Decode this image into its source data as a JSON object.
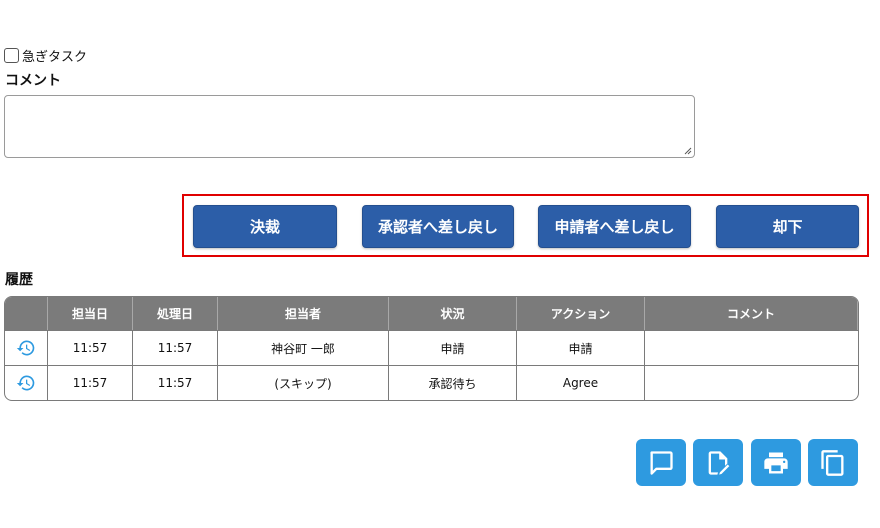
{
  "urgent": {
    "label": "急ぎタスク",
    "checked": false
  },
  "comment": {
    "label": "コメント",
    "value": ""
  },
  "actions": {
    "decide": "決裁",
    "return_to_approver": "承認者へ差し戻し",
    "return_to_applicant": "申請者へ差し戻し",
    "reject": "却下"
  },
  "history": {
    "label": "履歴",
    "headers": [
      "",
      "担当日",
      "処理日",
      "担当者",
      "状況",
      "アクション",
      "コメント"
    ],
    "rows": [
      {
        "icon": "history-icon",
        "assigned": "11:57",
        "processed": "11:57",
        "assignee": "神谷町 一郎",
        "status": "申請",
        "action": "申請",
        "comment": ""
      },
      {
        "icon": "history-icon",
        "assigned": "11:57",
        "processed": "11:57",
        "assignee": "(スキップ)",
        "status": "承認待ち",
        "action": "Agree",
        "comment": ""
      }
    ]
  },
  "fabs": [
    "comment-icon",
    "edit-document-icon",
    "print-icon",
    "copy-icon"
  ],
  "colors": {
    "primary_button": "#2c5ea8",
    "fab": "#2e9ae0",
    "table_header": "#7b7b7b",
    "highlight_frame": "#e00000"
  }
}
